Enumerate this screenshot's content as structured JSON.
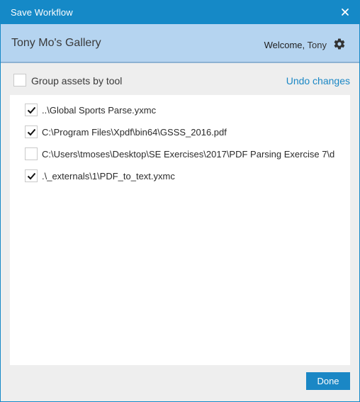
{
  "window": {
    "title": "Save Workflow",
    "close_icon": "close-icon"
  },
  "gallery": {
    "name": "Tony Mo's Gallery",
    "welcome_prefix": "Welcome,",
    "user_name": "Tony",
    "settings_icon": "gear-icon"
  },
  "options": {
    "group_label": "Group assets by tool",
    "group_checked": false,
    "undo_label": "Undo changes"
  },
  "assets": [
    {
      "path": "..\\Global Sports Parse.yxmc",
      "checked": true
    },
    {
      "path": "C:\\Program Files\\Xpdf\\bin64\\GSSS_2016.pdf",
      "checked": true
    },
    {
      "path": "C:\\Users\\tmoses\\Desktop\\SE Exercises\\2017\\PDF Parsing Exercise 7\\d",
      "checked": false
    },
    {
      "path": ".\\_externals\\1\\PDF_to_text.yxmc",
      "checked": true
    }
  ],
  "footer": {
    "done_label": "Done"
  },
  "colors": {
    "accent": "#1589c7",
    "header_band": "#b5d4f0",
    "link": "#1a87c5"
  }
}
